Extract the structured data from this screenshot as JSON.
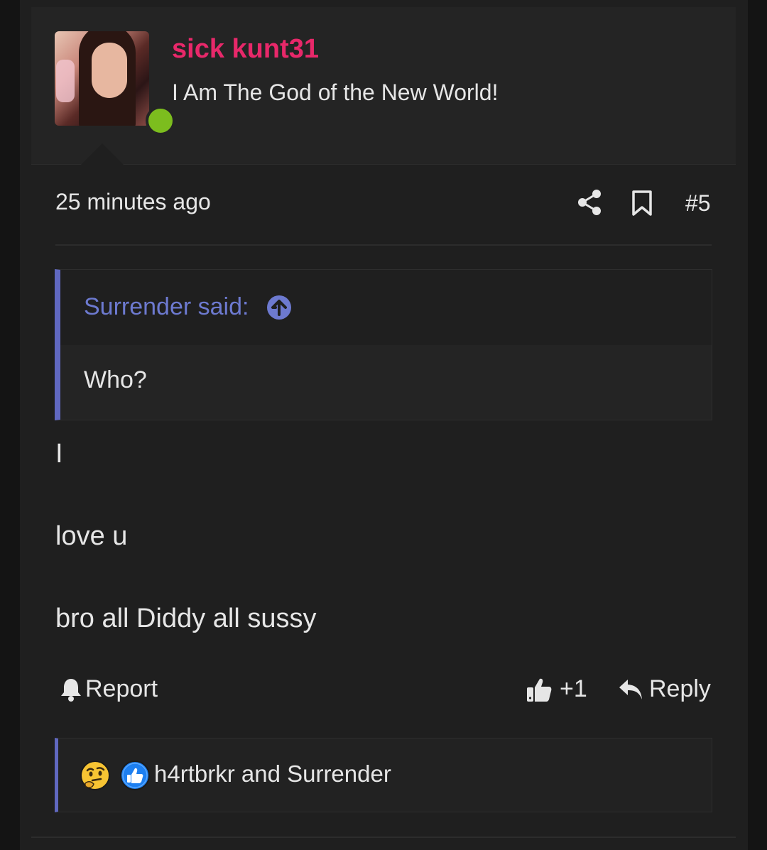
{
  "user": {
    "name": "sick kunt31",
    "title": "I Am The God of the New World!",
    "name_color": "#e8286a",
    "online_color": "#7cbd1e"
  },
  "post": {
    "time": "25 minutes ago",
    "number": "#5",
    "body": [
      "I",
      "love u",
      "bro all Diddy all sussy"
    ]
  },
  "quote": {
    "author": "Surrender said:",
    "text": "Who?",
    "accent": "#6068c0"
  },
  "actions": {
    "report": "Report",
    "like_count": "+1",
    "reply": "Reply"
  },
  "reactions": {
    "icons": [
      "thinking-face-icon",
      "thumbs-up-icon"
    ],
    "users": "h4rtbrkr and Surrender"
  }
}
